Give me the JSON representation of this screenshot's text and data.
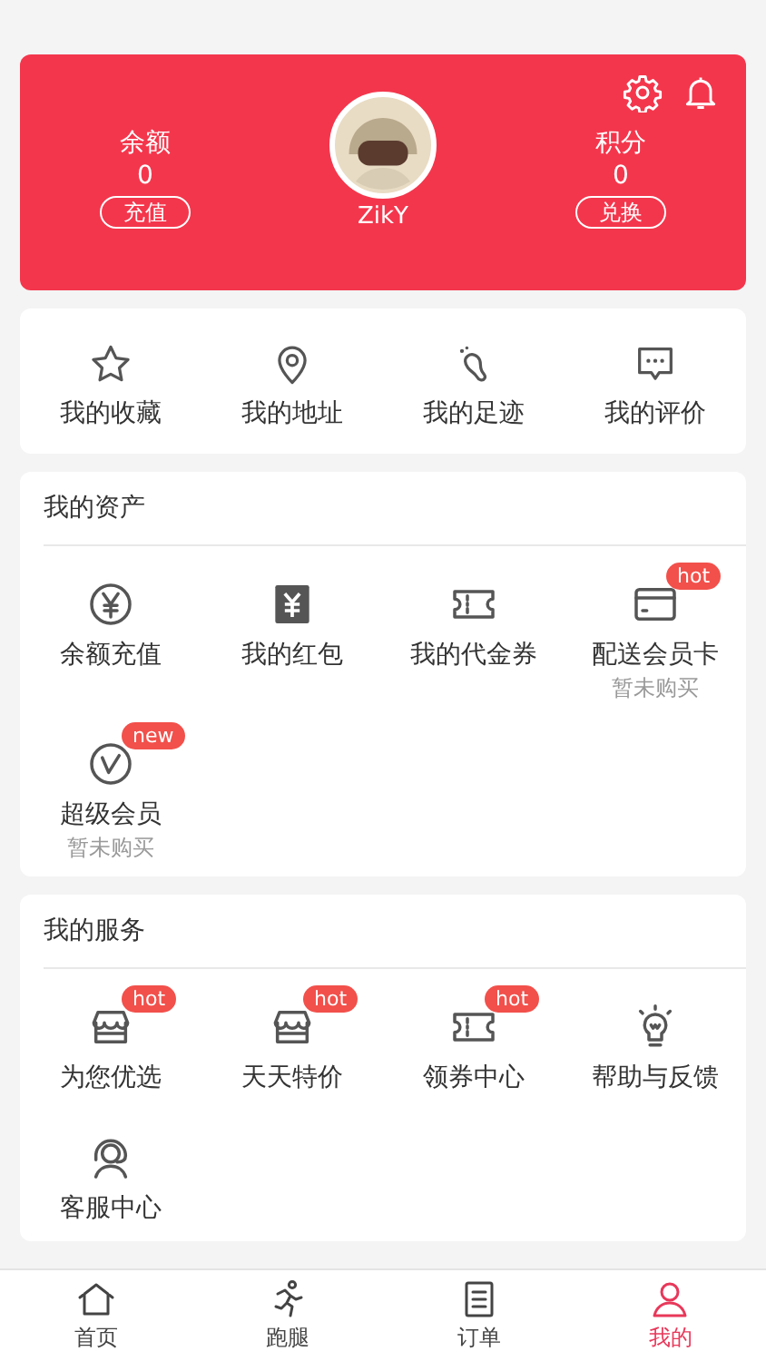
{
  "header": {
    "balance": {
      "label": "余额",
      "value": "0",
      "button": "充值"
    },
    "points": {
      "label": "积分",
      "value": "0",
      "button": "兑换"
    },
    "username": "ZikY"
  },
  "quick_links": [
    {
      "label": "我的收藏"
    },
    {
      "label": "我的地址"
    },
    {
      "label": "我的足迹"
    },
    {
      "label": "我的评价"
    }
  ],
  "sections": [
    {
      "title": "我的资产",
      "items": [
        {
          "label": "余额充值"
        },
        {
          "label": "我的红包"
        },
        {
          "label": "我的代金券"
        },
        {
          "label": "配送会员卡",
          "sub": "暂未购买",
          "badge": "hot"
        },
        {
          "label": "超级会员",
          "sub": "暂未购买",
          "badge": "new"
        }
      ]
    },
    {
      "title": "我的服务",
      "items": [
        {
          "label": "为您优选",
          "badge": "hot"
        },
        {
          "label": "天天特价",
          "badge": "hot"
        },
        {
          "label": "领券中心",
          "badge": "hot"
        },
        {
          "label": "帮助与反馈"
        },
        {
          "label": "客服中心"
        }
      ]
    }
  ],
  "tab_bar": [
    {
      "label": "首页",
      "selected": false
    },
    {
      "label": "跑腿",
      "selected": false
    },
    {
      "label": "订单",
      "selected": false
    },
    {
      "label": "我的",
      "selected": true
    }
  ]
}
